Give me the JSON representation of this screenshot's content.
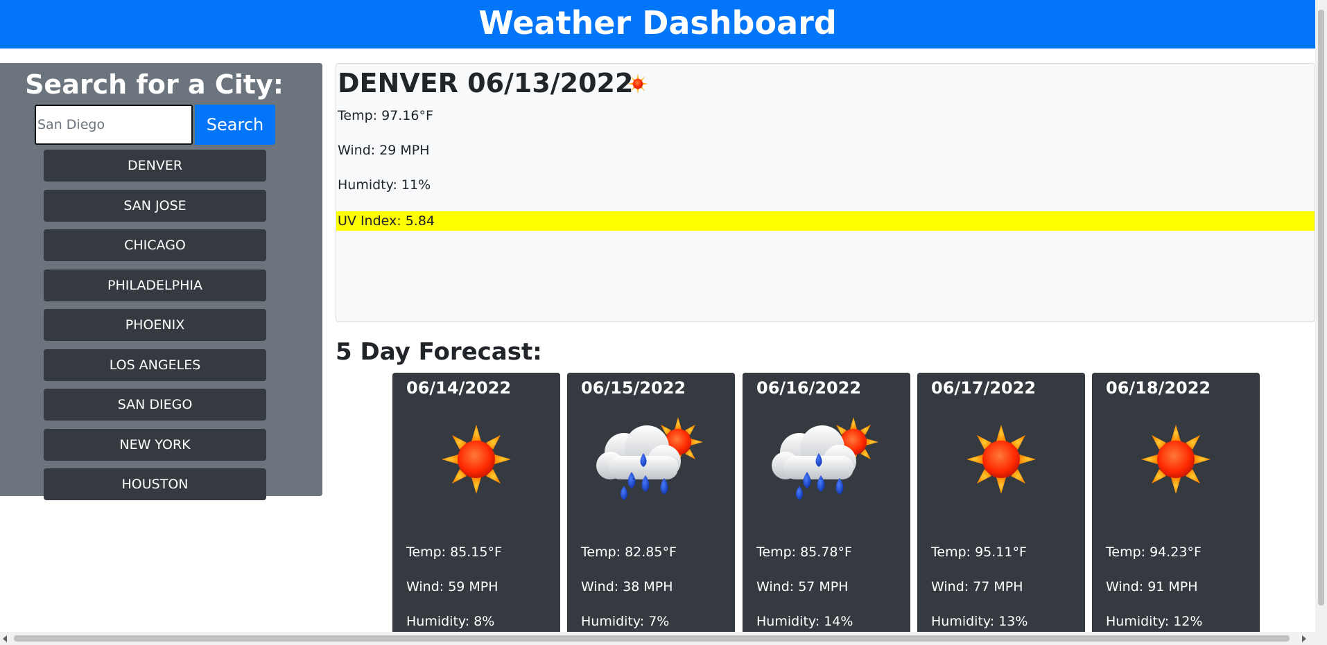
{
  "header": {
    "title": "Weather Dashboard"
  },
  "sidebar": {
    "heading": "Search for a City:",
    "search": {
      "placeholder": "San Diego",
      "value": ""
    },
    "search_label": "Search",
    "cities": [
      "DENVER",
      "SAN JOSE",
      "CHICAGO",
      "PHILADELPHIA",
      "PHOENIX",
      "LOS ANGELES",
      "SAN DIEGO",
      "NEW YORK",
      "HOUSTON"
    ]
  },
  "current": {
    "title": "DENVER 06/13/2022",
    "icon": "sun-icon",
    "temp": "Temp: 97.16°F",
    "wind": "Wind: 29 MPH",
    "humidity": "Humidty: 11%",
    "uv": "UV Index: 5.84",
    "uv_color": "#ffff00"
  },
  "forecast": {
    "title": "5 Day Forecast:",
    "days": [
      {
        "date": "06/14/2022",
        "icon": "sun-icon",
        "temp": "Temp: 85.15°F",
        "wind": "Wind: 59 MPH",
        "humidity": "Humidity: 8%"
      },
      {
        "date": "06/15/2022",
        "icon": "rain-cloud-sun-icon",
        "temp": "Temp: 82.85°F",
        "wind": "Wind: 38 MPH",
        "humidity": "Humidity: 7%"
      },
      {
        "date": "06/16/2022",
        "icon": "rain-cloud-sun-icon",
        "temp": "Temp: 85.78°F",
        "wind": "Wind: 57 MPH",
        "humidity": "Humidity: 14%"
      },
      {
        "date": "06/17/2022",
        "icon": "sun-icon",
        "temp": "Temp: 95.11°F",
        "wind": "Wind: 77 MPH",
        "humidity": "Humidity: 13%"
      },
      {
        "date": "06/18/2022",
        "icon": "sun-icon",
        "temp": "Temp: 94.23°F",
        "wind": "Wind: 91 MPH",
        "humidity": "Humidity: 12%"
      }
    ]
  },
  "colors": {
    "header": "#0275f9",
    "sidebar": "#6c757d",
    "card": "#343a40",
    "button": "#0275f9"
  }
}
